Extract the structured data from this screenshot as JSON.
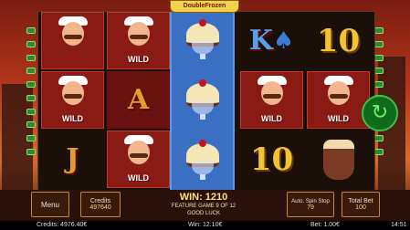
{
  "game": {
    "logo_text": "DoubleFrozen"
  },
  "symbols": {
    "wild_label": "WILD",
    "letter_a": "A",
    "letter_j": "J",
    "letter_k": "K",
    "ten": "10",
    "spade": "♠"
  },
  "controls": {
    "menu_label": "Menu",
    "credits_label": "Credits",
    "credits_value": "497640",
    "win_text": "WIN: 1210",
    "feature_text": "FEATURE GAME 9 OF 12",
    "good_luck_text": "GOOD LUCK",
    "auto_spin_label": "Auto. Spin Stop",
    "auto_spin_value": "79",
    "total_bet_label": "Total Bet",
    "total_bet_value": "100",
    "spin_icon": "↻"
  },
  "status_bar": {
    "credits": "Credits: 4976.40€",
    "win": "Win: 12.10€",
    "bet": "Bet: 1.00€",
    "time": "14:51"
  },
  "colors": {
    "accent_green": "#38c04a",
    "gold": "#f1c232",
    "reel_blue": "#3a6fc4"
  }
}
